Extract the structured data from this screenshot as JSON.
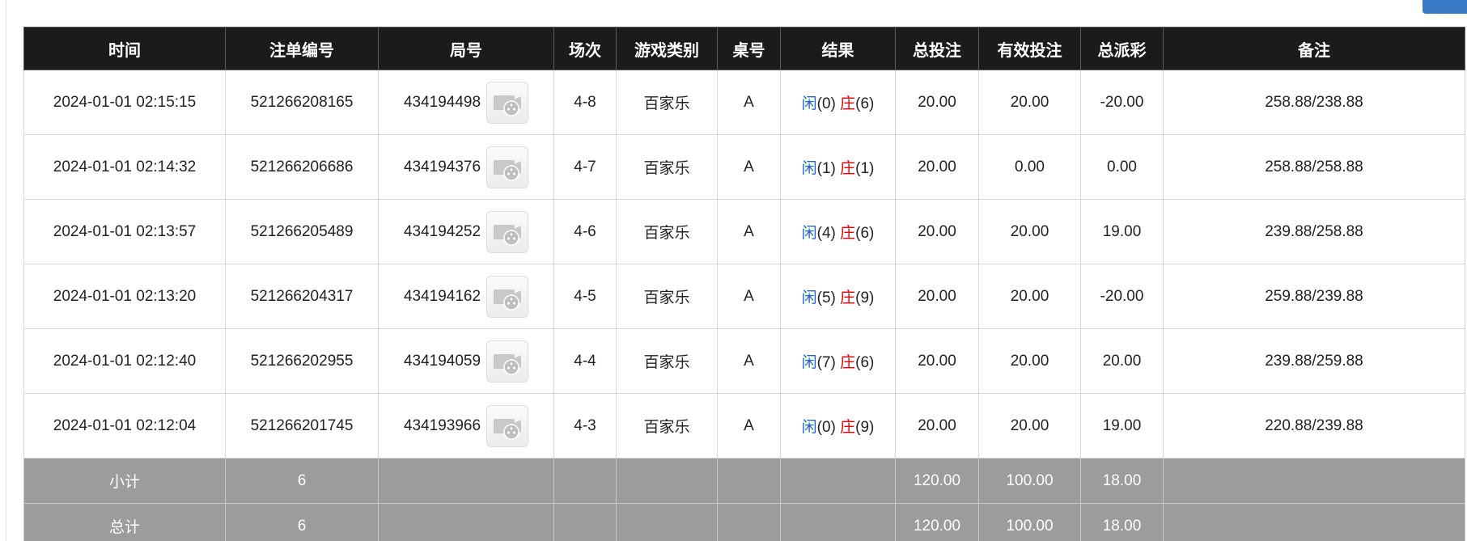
{
  "table": {
    "headers": [
      "时间",
      "注单编号",
      "局号",
      "场次",
      "游戏类别",
      "桌号",
      "结果",
      "总投注",
      "有效投注",
      "总派彩",
      "备注"
    ],
    "rows": [
      {
        "time": "2024-01-01 02:15:15",
        "bet_no": "521266208165",
        "round_no": "434194498",
        "session": "4-8",
        "game": "百家乐",
        "table_no": "A",
        "result": {
          "player_label": "闲",
          "player_score": "(0)",
          "banker_label": "庄",
          "banker_score": "(6)"
        },
        "total_bet": "20.00",
        "valid_bet": "20.00",
        "payout": "-20.00",
        "note": "258.88/238.88"
      },
      {
        "time": "2024-01-01 02:14:32",
        "bet_no": "521266206686",
        "round_no": "434194376",
        "session": "4-7",
        "game": "百家乐",
        "table_no": "A",
        "result": {
          "player_label": "闲",
          "player_score": "(1)",
          "banker_label": "庄",
          "banker_score": "(1)"
        },
        "total_bet": "20.00",
        "valid_bet": "0.00",
        "payout": "0.00",
        "note": "258.88/258.88"
      },
      {
        "time": "2024-01-01 02:13:57",
        "bet_no": "521266205489",
        "round_no": "434194252",
        "session": "4-6",
        "game": "百家乐",
        "table_no": "A",
        "result": {
          "player_label": "闲",
          "player_score": "(4)",
          "banker_label": "庄",
          "banker_score": "(6)"
        },
        "total_bet": "20.00",
        "valid_bet": "20.00",
        "payout": "19.00",
        "note": "239.88/258.88"
      },
      {
        "time": "2024-01-01 02:13:20",
        "bet_no": "521266204317",
        "round_no": "434194162",
        "session": "4-5",
        "game": "百家乐",
        "table_no": "A",
        "result": {
          "player_label": "闲",
          "player_score": "(5)",
          "banker_label": "庄",
          "banker_score": "(9)"
        },
        "total_bet": "20.00",
        "valid_bet": "20.00",
        "payout": "-20.00",
        "note": "259.88/239.88"
      },
      {
        "time": "2024-01-01 02:12:40",
        "bet_no": "521266202955",
        "round_no": "434194059",
        "session": "4-4",
        "game": "百家乐",
        "table_no": "A",
        "result": {
          "player_label": "闲",
          "player_score": "(7)",
          "banker_label": "庄",
          "banker_score": "(6)"
        },
        "total_bet": "20.00",
        "valid_bet": "20.00",
        "payout": "20.00",
        "note": "239.88/259.88"
      },
      {
        "time": "2024-01-01 02:12:04",
        "bet_no": "521266201745",
        "round_no": "434193966",
        "session": "4-3",
        "game": "百家乐",
        "table_no": "A",
        "result": {
          "player_label": "闲",
          "player_score": "(0)",
          "banker_label": "庄",
          "banker_score": "(9)"
        },
        "total_bet": "20.00",
        "valid_bet": "20.00",
        "payout": "19.00",
        "note": "220.88/239.88"
      }
    ],
    "subtotal": {
      "label": "小计",
      "count": "6",
      "total_bet": "120.00",
      "valid_bet": "100.00",
      "payout": "18.00"
    },
    "grand_total": {
      "label": "总计",
      "count": "6",
      "total_bet": "120.00",
      "valid_bet": "100.00",
      "payout": "18.00"
    }
  },
  "icons": {
    "video_replay": "video-replay-icon"
  },
  "colors": {
    "header_bg": "#1b1b1b",
    "footer_bg": "#9c9c9c",
    "bet_blue": "#1a63d6",
    "loss_red": "#e8000b",
    "top_button": "#3a7bc8"
  }
}
